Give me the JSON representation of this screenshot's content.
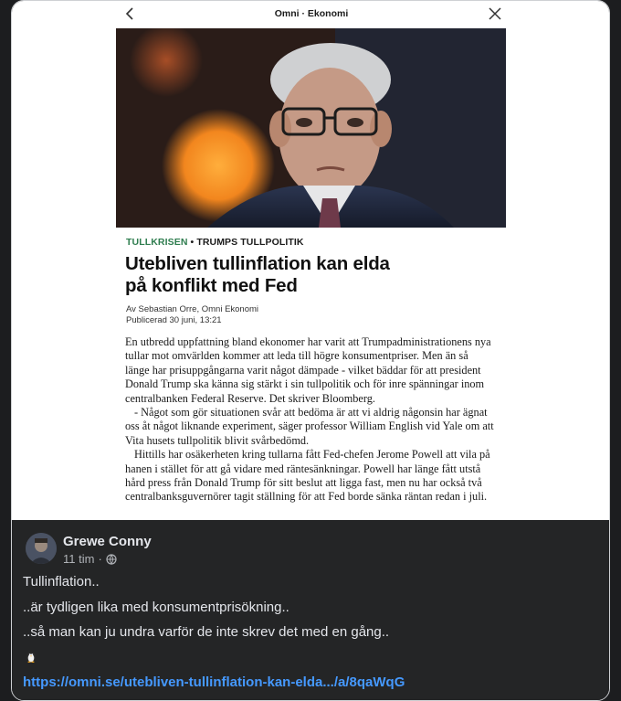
{
  "screenshot": {
    "topbar": {
      "title": "Omni · Ekonomi"
    },
    "article": {
      "kicker_tag": "TULLKRISEN",
      "kicker_sep": " • ",
      "kicker_topic": "TRUMPS TULLPOLITIK",
      "headline": "Utebliven tullinflation kan elda på konflikt med Fed",
      "byline": "Av Sebastian Orre, Omni Ekonomi",
      "published": "Publicerad 30 juni, 13:21",
      "paragraphs": [
        "En utbredd uppfattning bland ekonomer har varit att Trumpadministrationens nya tullar mot omvärlden kommer att leda till högre konsumentpriser. Men än så länge har prisuppgångarna varit något dämpade - vilket bäddar för att president Donald Trump ska känna sig stärkt i sin tullpolitik och för inre spänningar inom centralbanken Federal Reserve. Det skriver Bloomberg.",
        "- Något som gör situationen svår att bedöma är att vi aldrig någonsin har ägnat oss åt något liknande experiment, säger professor William English vid Yale om att Vita husets tullpolitik blivit svårbedömd.",
        "Hittills har osäkerheten kring tullarna fått Fed-chefen Jerome Powell att vila på hanen i stället för att gå vidare med räntesänkningar. Powell har länge fått utstå hård press från Donald Trump för sitt beslut att ligga fast, men nu har också två centralbanksguvernörer tagit ställning för att Fed borde sänka räntan redan i juli."
      ]
    }
  },
  "post": {
    "author": "Grewe Conny",
    "time": "11 tim",
    "time_sep": "·",
    "lines": [
      "Tullinflation..",
      "..är tydligen lika med konsumentprisökning..",
      "..så man kan ju undra varför de inte skrev det med en gång.."
    ],
    "link": "https://omni.se/utebliven-tullinflation-kan-elda.../a/8qaWqG"
  },
  "colors": {
    "post_background": "#242526",
    "link": "#4599ff",
    "kicker_accent": "#2f7d4f"
  },
  "icons": [
    "chevron-left-icon",
    "close-icon",
    "globe-icon",
    "penguin-icon"
  ]
}
